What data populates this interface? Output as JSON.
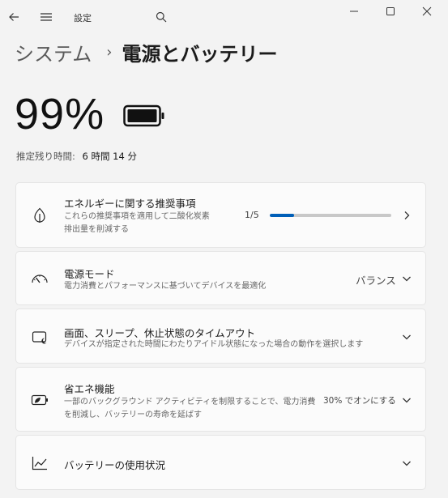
{
  "window": {
    "title": "設定"
  },
  "breadcrumb": {
    "parent": "システム",
    "separator": "›",
    "current": "電源とバッテリー"
  },
  "battery": {
    "percent": "99%",
    "estimate_label": "推定残り時間:",
    "estimate_value": "6 時間 14 分"
  },
  "cards": {
    "recommendations": {
      "title": "エネルギーに関する推奨事項",
      "desc_line1": "これらの推奨事項を適用して二酸化炭素",
      "desc_line2": "排出量を削減する",
      "progress_label": "1/5",
      "progress_fraction": 0.2
    },
    "power_mode": {
      "title": "電源モード",
      "desc": "電力消費とパフォーマンスに基づいてデバイスを最適化",
      "value": "バランス"
    },
    "sleep": {
      "title": "画面、スリープ、休止状態のタイムアウト",
      "desc": "デバイスが指定された時間にわたりアイドル状態になった場合の動作を選択します"
    },
    "saver": {
      "title": "省エネ機能",
      "desc_line1": "一部のバックグラウンド アクティビティを制限することで、電力消費",
      "desc_line2": "を削減し、バッテリーの寿命を延ばす",
      "value": "30% でオンにする"
    },
    "usage": {
      "title": "バッテリーの使用状況"
    }
  },
  "colors": {
    "accent": "#005fb8",
    "background": "#f3f3f3",
    "card": "#fbfbfb"
  },
  "icons": {
    "back": "back-arrow-icon",
    "menu": "hamburger-icon",
    "search": "search-icon",
    "minimize": "minimize-icon",
    "maximize": "maximize-icon",
    "close": "close-icon",
    "battery": "battery-full-icon",
    "leaf": "leaf-icon",
    "gauge": "gauge-icon",
    "screen": "screen-sleep-icon",
    "saver": "battery-saver-icon",
    "chart": "line-chart-icon"
  }
}
